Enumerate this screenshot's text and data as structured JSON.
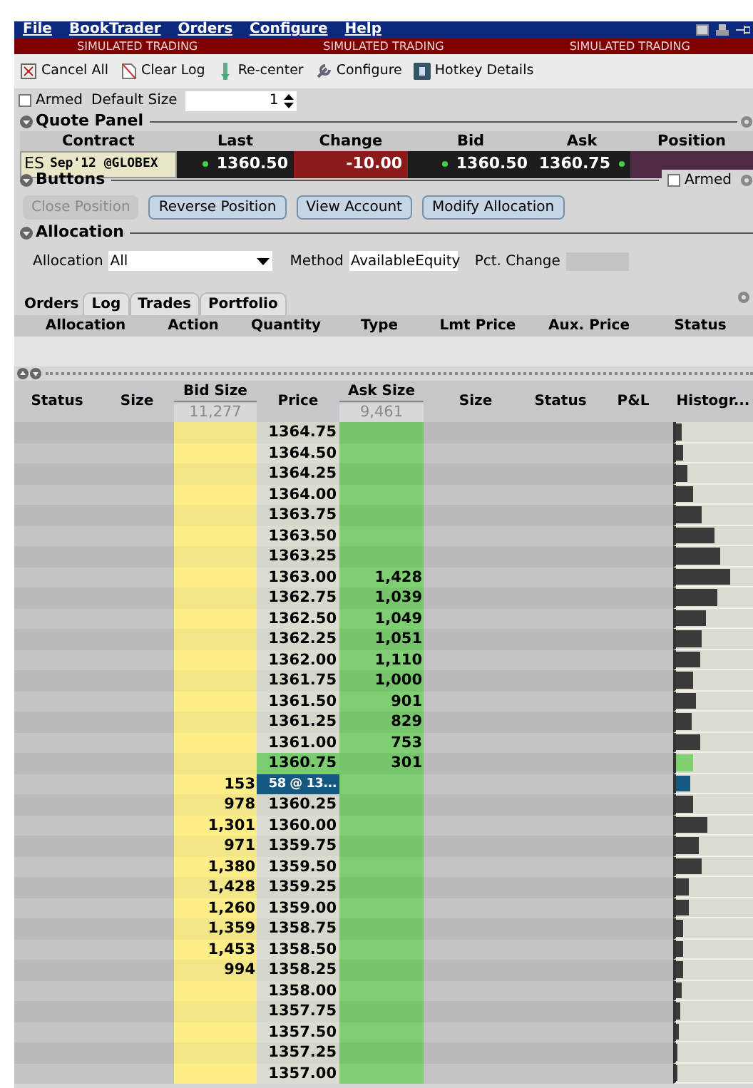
{
  "menu": [
    "File",
    "BookTrader",
    "Orders",
    "Configure",
    "Help"
  ],
  "banner": [
    "SIMULATED TRADING",
    "SIMULATED TRADING",
    "SIMULATED TRADING"
  ],
  "toolbar": [
    {
      "label": "Cancel All",
      "kind": "cancel"
    },
    {
      "label": "Clear Log",
      "kind": "clear"
    },
    {
      "label": "Re-center",
      "kind": "recenter"
    },
    {
      "label": "Configure",
      "kind": "configure"
    },
    {
      "label": "Hotkey Details",
      "kind": "hotkey"
    }
  ],
  "armed": {
    "label": "Armed",
    "checked": false
  },
  "default_size": {
    "label": "Default Size",
    "value": "1"
  },
  "quote_panel": {
    "title": "Quote Panel",
    "columns": [
      "Contract",
      "Last",
      "Change",
      "Bid",
      "Ask",
      "Position"
    ],
    "row": {
      "symbol": "ES",
      "contract": "Sep'12 @GLOBEX",
      "last": "1360.50",
      "change": "-10.00",
      "bid": "1360.50",
      "ask": "1360.75"
    }
  },
  "buttons_panel": {
    "title": "Buttons",
    "armed": {
      "label": "Armed",
      "checked": false
    },
    "buttons": [
      {
        "label": "Close Position",
        "disabled": true
      },
      {
        "label": "Reverse Position",
        "disabled": false
      },
      {
        "label": "View Account",
        "disabled": false
      },
      {
        "label": "Modify Allocation",
        "disabled": false
      }
    ]
  },
  "allocation_panel": {
    "title": "Allocation",
    "fields": [
      {
        "label": "Allocation",
        "value": "All",
        "kind": "dropdown"
      },
      {
        "label": "Method",
        "value": "AvailableEquity",
        "kind": "dropdown"
      },
      {
        "label": "Pct. Change",
        "kind": "text"
      }
    ]
  },
  "tabs": [
    {
      "label": "Orders",
      "selected": true
    },
    {
      "label": "Log",
      "selected": false
    },
    {
      "label": "Trades",
      "selected": false
    },
    {
      "label": "Portfolio",
      "selected": false
    }
  ],
  "orders_table": {
    "columns": [
      "Allocation",
      "Action",
      "Quantity",
      "Type",
      "Lmt Price",
      "Aux. Price",
      "Status"
    ]
  },
  "book": {
    "columns": [
      "Status",
      "Size",
      "Bid Size",
      "Price",
      "Ask Size",
      "Size",
      "Status",
      "P&L",
      "Histogr..."
    ],
    "bid_total": "11,277",
    "ask_total": "9,461",
    "rows": [
      {
        "price": "1364.75",
        "kind": "level",
        "level": 0.07
      },
      {
        "price": "1364.50",
        "kind": "level",
        "level": 0.09
      },
      {
        "price": "1364.25",
        "kind": "level",
        "level": 0.14
      },
      {
        "price": "1364.00",
        "kind": "level",
        "level": 0.23
      },
      {
        "price": "1363.75",
        "kind": "level",
        "level": 0.34
      },
      {
        "price": "1363.50",
        "kind": "level",
        "level": 0.5
      },
      {
        "price": "1363.25",
        "kind": "level",
        "level": 0.57
      },
      {
        "price": "1363.00",
        "ask_size": "1,428",
        "kind": "level",
        "level": 0.7
      },
      {
        "price": "1362.75",
        "ask_size": "1,039",
        "kind": "level",
        "level": 0.54
      },
      {
        "price": "1362.50",
        "ask_size": "1,049",
        "kind": "level",
        "level": 0.39
      },
      {
        "price": "1362.25",
        "ask_size": "1,051",
        "kind": "level",
        "level": 0.34
      },
      {
        "price": "1362.00",
        "ask_size": "1,110",
        "kind": "level",
        "level": 0.32
      },
      {
        "price": "1361.75",
        "ask_size": "1,000",
        "kind": "level",
        "level": 0.23
      },
      {
        "price": "1361.50",
        "ask_size": "901",
        "kind": "level",
        "level": 0.25
      },
      {
        "price": "1361.25",
        "ask_size": "829",
        "kind": "level",
        "level": 0.2
      },
      {
        "price": "1361.00",
        "ask_size": "753",
        "kind": "level",
        "level": 0.32
      },
      {
        "price": "1360.75",
        "ask_size": "301",
        "kind": "best_ask",
        "level": 0.23
      },
      {
        "price": "58 @ 13...",
        "bid_size": "153",
        "kind": "last_trade",
        "level": 0.18
      },
      {
        "price": "1360.25",
        "bid_size": "978",
        "kind": "level",
        "level": 0.23
      },
      {
        "price": "1360.00",
        "bid_size": "1,301",
        "kind": "level",
        "level": 0.41
      },
      {
        "price": "1359.75",
        "bid_size": "971",
        "kind": "level",
        "level": 0.3
      },
      {
        "price": "1359.50",
        "bid_size": "1,380",
        "kind": "level",
        "level": 0.34
      },
      {
        "price": "1359.25",
        "bid_size": "1,428",
        "kind": "level",
        "level": 0.16
      },
      {
        "price": "1359.00",
        "bid_size": "1,260",
        "kind": "level",
        "level": 0.16
      },
      {
        "price": "1358.75",
        "bid_size": "1,359",
        "kind": "level",
        "level": 0.09
      },
      {
        "price": "1358.50",
        "bid_size": "1,453",
        "kind": "level",
        "level": 0.09
      },
      {
        "price": "1358.25",
        "bid_size": "994",
        "kind": "level",
        "level": 0.1
      },
      {
        "price": "1358.00",
        "kind": "level",
        "level": 0.07
      },
      {
        "price": "1357.75",
        "kind": "level",
        "level": 0.05
      },
      {
        "price": "1357.50",
        "kind": "level",
        "level": 0.03
      },
      {
        "price": "1357.25",
        "kind": "level",
        "level": 0.02
      },
      {
        "price": "1357.00",
        "kind": "level",
        "level": 0.02
      }
    ]
  }
}
